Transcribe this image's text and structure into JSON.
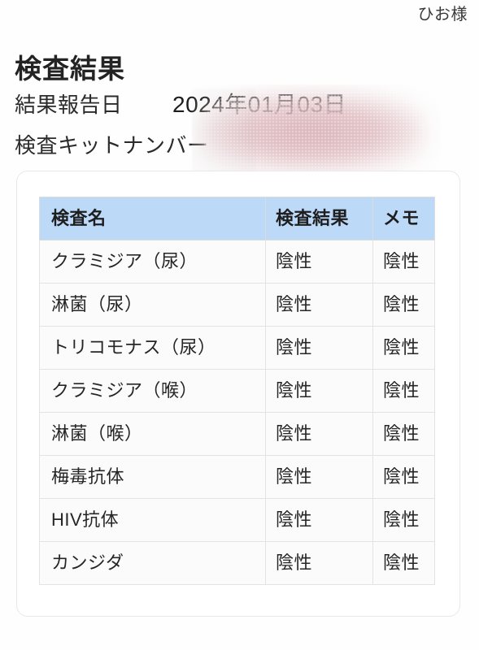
{
  "header": {
    "customer_name": "ひお様",
    "page_title": "検査結果"
  },
  "info": {
    "report_date": {
      "label": "結果報告日",
      "value": "2024年01月03日"
    },
    "kit_number": {
      "label": "検査キットナンバー",
      "value": ""
    },
    "redaction_color": "#d6aab0"
  },
  "table": {
    "columns": [
      {
        "key": "name",
        "label": "検査名"
      },
      {
        "key": "result",
        "label": "検査結果"
      },
      {
        "key": "memo",
        "label": "メモ"
      }
    ],
    "header_bg": "#bcd9f7",
    "rows": [
      {
        "name": "クラミジア（尿）",
        "result": "陰性",
        "memo": "陰性"
      },
      {
        "name": "淋菌（尿）",
        "result": "陰性",
        "memo": "陰性"
      },
      {
        "name": "トリコモナス（尿）",
        "result": "陰性",
        "memo": "陰性"
      },
      {
        "name": "クラミジア（喉）",
        "result": "陰性",
        "memo": "陰性"
      },
      {
        "name": "淋菌（喉）",
        "result": "陰性",
        "memo": "陰性"
      },
      {
        "name": "梅毒抗体",
        "result": "陰性",
        "memo": "陰性"
      },
      {
        "name": "HIV抗体",
        "result": "陰性",
        "memo": "陰性"
      },
      {
        "name": "カンジダ",
        "result": "陰性",
        "memo": "陰性"
      }
    ]
  }
}
